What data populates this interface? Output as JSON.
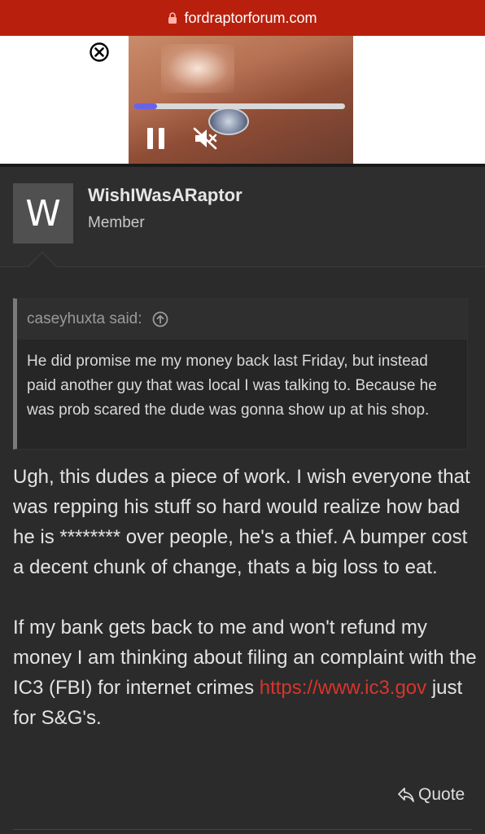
{
  "browser": {
    "url": "fordraptorforum.com"
  },
  "ad": {
    "progress_fraction": 0.11,
    "progress_color": "#6a63e8"
  },
  "post": {
    "avatar_letter": "W",
    "username": "WishIWasARaptor",
    "role": "Member",
    "quote": {
      "author_label": "caseyhuxta said:",
      "text": "He did promise me my money back last Friday, but instead paid another guy that was local I was talking to. Because he was prob scared the dude was gonna show up at his shop."
    },
    "message": {
      "paragraph1": "Ugh, this dudes a piece of work. I wish everyone that was repping his stuff so hard would realize how bad he is ******** over people, he's a thief. A bumper cost a decent chunk of change, thats a big loss to eat.",
      "paragraph2_before": "If my bank gets back to me and won't refund my money I am thinking about filing an complaint with the IC3 (FBI) for internet crimes ",
      "link_text": "https://www.ic3.gov",
      "paragraph2_after": " just for S&G's."
    },
    "quote_action_label": "Quote"
  },
  "colors": {
    "url_bar": "#b8200d",
    "link": "#d9342b",
    "background": "#2b2b2b"
  }
}
